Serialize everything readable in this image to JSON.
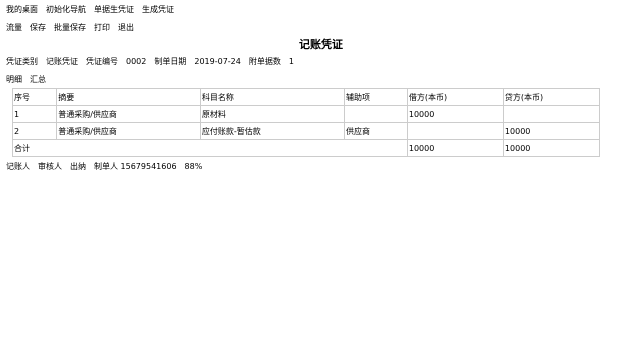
{
  "tabs": [
    "我的桌面",
    "初始化导航",
    "单据生凭证",
    "生成凭证"
  ],
  "toolbar": [
    "流量",
    "保存",
    "批量保存",
    "打印",
    "退出"
  ],
  "title": "记账凭证",
  "type_label": "凭证类别",
  "type_value": "记账凭证",
  "no_label": "凭证编号",
  "no_value": "0002",
  "date_label": "制单日期",
  "date_value": "2019-07-24",
  "att_label": "附单据数",
  "att_value": "1",
  "subtabs": [
    "明细",
    "汇总"
  ],
  "headers": [
    "序号",
    "摘要",
    "科目名称",
    "辅助项",
    "借方(本币)",
    "贷方(本币)"
  ],
  "rows": [
    [
      "1",
      "普通采购/供应商",
      "原材料",
      "",
      "10000",
      ""
    ],
    [
      "2",
      "普通采购/供应商",
      "应付账款-暂估款",
      "供应商",
      "",
      "10000"
    ]
  ],
  "total_label": "合计",
  "total_debit": "10000",
  "total_credit": "10000",
  "sig": [
    "记账人",
    "审核人",
    "出纳",
    "制单人 15679541606"
  ],
  "gauge": "88%"
}
